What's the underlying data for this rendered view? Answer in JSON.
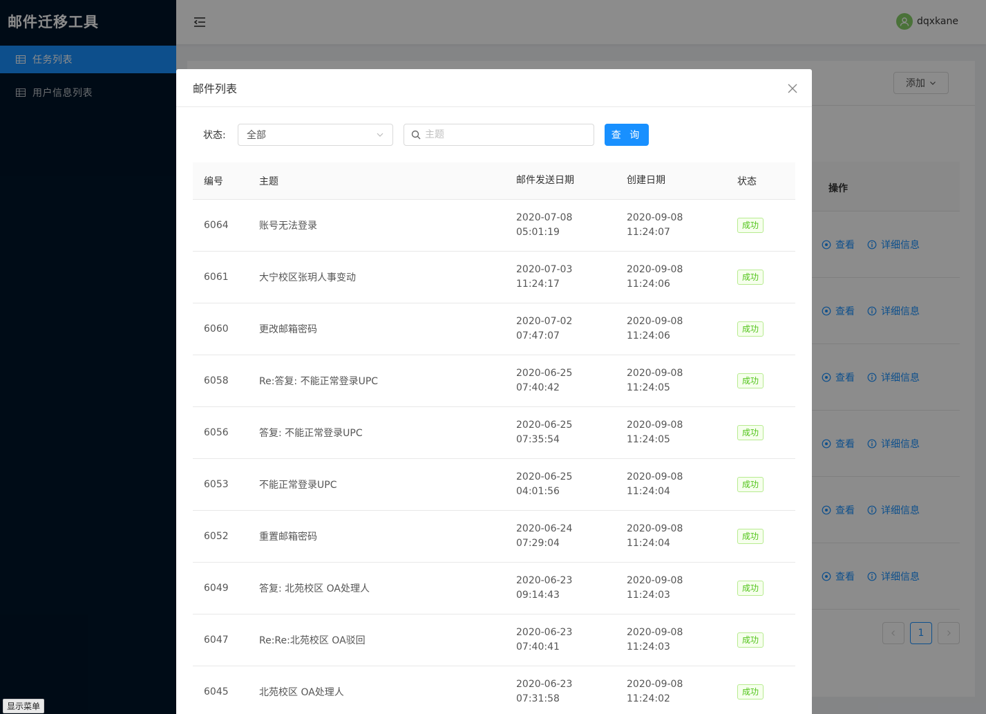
{
  "app": {
    "title": "邮件迁移工具"
  },
  "sidebar": {
    "items": [
      {
        "label": "任务列表",
        "active": true
      },
      {
        "label": "用户信息列表",
        "active": false
      }
    ],
    "show_menu_label": "显示菜单"
  },
  "header": {
    "username": "dqxkane"
  },
  "background": {
    "add_button": "添加",
    "op_column": "操作",
    "view_label": "查看",
    "detail_label": "详细信息",
    "current_page": "1"
  },
  "modal": {
    "title": "邮件列表",
    "filter": {
      "status_label": "状态:",
      "status_value": "全部",
      "subject_placeholder": "主题",
      "query_button": "查 询"
    },
    "columns": {
      "id": "编号",
      "subject": "主题",
      "send_date": "邮件发送日期",
      "create_date": "创建日期",
      "status": "状态"
    },
    "rows": [
      {
        "id": "6064",
        "subject": "账号无法登录",
        "send_date": "2020-07-08",
        "send_time": "05:01:19",
        "create_date": "2020-09-08",
        "create_time": "11:24:07",
        "status": "成功"
      },
      {
        "id": "6061",
        "subject": "大宁校区张玥人事变动",
        "send_date": "2020-07-03",
        "send_time": "11:24:17",
        "create_date": "2020-09-08",
        "create_time": "11:24:06",
        "status": "成功"
      },
      {
        "id": "6060",
        "subject": "更改邮箱密码",
        "send_date": "2020-07-02",
        "send_time": "07:47:07",
        "create_date": "2020-09-08",
        "create_time": "11:24:06",
        "status": "成功"
      },
      {
        "id": "6058",
        "subject": "Re:答复: 不能正常登录UPC",
        "send_date": "2020-06-25",
        "send_time": "07:40:42",
        "create_date": "2020-09-08",
        "create_time": "11:24:05",
        "status": "成功"
      },
      {
        "id": "6056",
        "subject": "答复: 不能正常登录UPC",
        "send_date": "2020-06-25",
        "send_time": "07:35:54",
        "create_date": "2020-09-08",
        "create_time": "11:24:05",
        "status": "成功"
      },
      {
        "id": "6053",
        "subject": "不能正常登录UPC",
        "send_date": "2020-06-25",
        "send_time": "04:01:56",
        "create_date": "2020-09-08",
        "create_time": "11:24:04",
        "status": "成功"
      },
      {
        "id": "6052",
        "subject": "重置邮箱密码",
        "send_date": "2020-06-24",
        "send_time": "07:29:04",
        "create_date": "2020-09-08",
        "create_time": "11:24:04",
        "status": "成功"
      },
      {
        "id": "6049",
        "subject": "答复: 北苑校区 OA处理人",
        "send_date": "2020-06-23",
        "send_time": "09:14:43",
        "create_date": "2020-09-08",
        "create_time": "11:24:03",
        "status": "成功"
      },
      {
        "id": "6047",
        "subject": "Re:Re:北苑校区 OA驳回",
        "send_date": "2020-06-23",
        "send_time": "07:40:41",
        "create_date": "2020-09-08",
        "create_time": "11:24:03",
        "status": "成功"
      },
      {
        "id": "6045",
        "subject": "北苑校区 OA处理人",
        "send_date": "2020-06-23",
        "send_time": "07:31:58",
        "create_date": "2020-09-08",
        "create_time": "11:24:02",
        "status": "成功"
      }
    ]
  },
  "colors": {
    "sidebar_bg": "#001529",
    "accent": "#1890ff",
    "success_text": "#52c41a",
    "success_bg": "#f6ffed",
    "success_border": "#b7eb8f"
  }
}
